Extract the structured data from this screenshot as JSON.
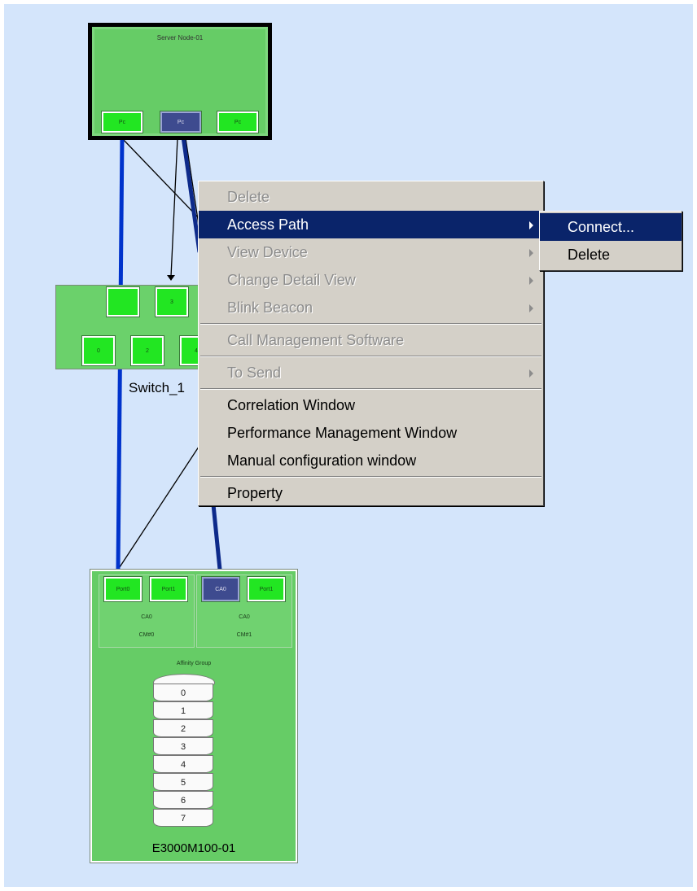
{
  "server": {
    "name": "Server Node-01",
    "ports": [
      "Pc",
      "Pc",
      "Pc"
    ]
  },
  "switch": {
    "name": "Switch_1",
    "top_ports": [
      "",
      "3"
    ],
    "bottom_ports": [
      "0",
      "2",
      "4"
    ]
  },
  "storage": {
    "name": "E3000M100-01",
    "ca_left": {
      "ports": [
        "Port0",
        "Port1"
      ],
      "ca": "CA0",
      "cm": "CM#0"
    },
    "ca_right": {
      "ports": [
        "CA0",
        "Port1"
      ],
      "ca": "CA0",
      "cm": "CM#1"
    },
    "affinity_group": "Affinity Group",
    "luns": [
      "0",
      "1",
      "2",
      "3",
      "4",
      "5",
      "6",
      "7"
    ]
  },
  "context_menu": {
    "items": [
      {
        "label": "Delete",
        "enabled": false,
        "submenu": false
      },
      {
        "label": "Access Path",
        "enabled": true,
        "submenu": true,
        "highlighted": true
      },
      {
        "label": "View Device",
        "enabled": false,
        "submenu": true
      },
      {
        "label": "Change Detail View",
        "enabled": false,
        "submenu": true
      },
      {
        "label": "Blink Beacon",
        "enabled": false,
        "submenu": true
      },
      {
        "label": "Call Management Software",
        "enabled": false,
        "submenu": false
      },
      {
        "label": "To Send",
        "enabled": false,
        "submenu": true
      },
      {
        "label": "Correlation Window",
        "enabled": true,
        "submenu": false
      },
      {
        "label": "Performance Management Window",
        "enabled": true,
        "submenu": false
      },
      {
        "label": "Manual configuration window",
        "enabled": true,
        "submenu": false
      },
      {
        "label": "Property",
        "enabled": true,
        "submenu": false
      }
    ]
  },
  "submenu": {
    "items": [
      {
        "label": "Connect...",
        "highlighted": true
      },
      {
        "label": "Delete",
        "highlighted": false
      }
    ]
  },
  "colors": {
    "background": "#d4e5fb",
    "node_green": "#66cc66",
    "port_green": "#22e622",
    "selected_port": "#3e4b8f",
    "path_blue": "#0033cc",
    "menu_highlight": "#0a246a"
  }
}
